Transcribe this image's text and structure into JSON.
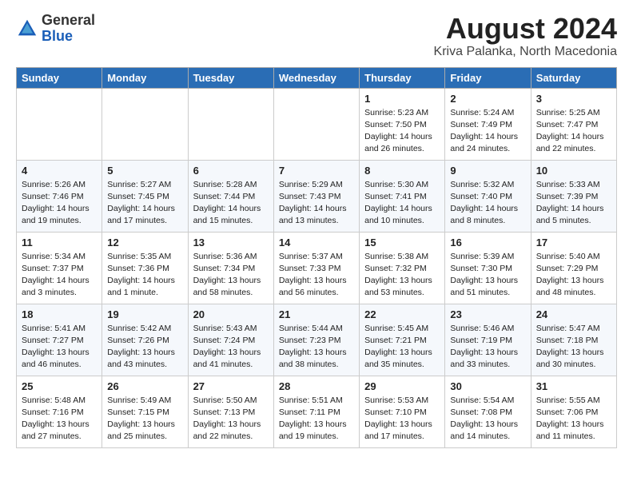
{
  "logo": {
    "general": "General",
    "blue": "Blue"
  },
  "title": {
    "month_year": "August 2024",
    "location": "Kriva Palanka, North Macedonia"
  },
  "headers": [
    "Sunday",
    "Monday",
    "Tuesday",
    "Wednesday",
    "Thursday",
    "Friday",
    "Saturday"
  ],
  "weeks": [
    [
      {
        "day": "",
        "info": ""
      },
      {
        "day": "",
        "info": ""
      },
      {
        "day": "",
        "info": ""
      },
      {
        "day": "",
        "info": ""
      },
      {
        "day": "1",
        "info": "Sunrise: 5:23 AM\nSunset: 7:50 PM\nDaylight: 14 hours and 26 minutes."
      },
      {
        "day": "2",
        "info": "Sunrise: 5:24 AM\nSunset: 7:49 PM\nDaylight: 14 hours and 24 minutes."
      },
      {
        "day": "3",
        "info": "Sunrise: 5:25 AM\nSunset: 7:47 PM\nDaylight: 14 hours and 22 minutes."
      }
    ],
    [
      {
        "day": "4",
        "info": "Sunrise: 5:26 AM\nSunset: 7:46 PM\nDaylight: 14 hours and 19 minutes."
      },
      {
        "day": "5",
        "info": "Sunrise: 5:27 AM\nSunset: 7:45 PM\nDaylight: 14 hours and 17 minutes."
      },
      {
        "day": "6",
        "info": "Sunrise: 5:28 AM\nSunset: 7:44 PM\nDaylight: 14 hours and 15 minutes."
      },
      {
        "day": "7",
        "info": "Sunrise: 5:29 AM\nSunset: 7:43 PM\nDaylight: 14 hours and 13 minutes."
      },
      {
        "day": "8",
        "info": "Sunrise: 5:30 AM\nSunset: 7:41 PM\nDaylight: 14 hours and 10 minutes."
      },
      {
        "day": "9",
        "info": "Sunrise: 5:32 AM\nSunset: 7:40 PM\nDaylight: 14 hours and 8 minutes."
      },
      {
        "day": "10",
        "info": "Sunrise: 5:33 AM\nSunset: 7:39 PM\nDaylight: 14 hours and 5 minutes."
      }
    ],
    [
      {
        "day": "11",
        "info": "Sunrise: 5:34 AM\nSunset: 7:37 PM\nDaylight: 14 hours and 3 minutes."
      },
      {
        "day": "12",
        "info": "Sunrise: 5:35 AM\nSunset: 7:36 PM\nDaylight: 14 hours and 1 minute."
      },
      {
        "day": "13",
        "info": "Sunrise: 5:36 AM\nSunset: 7:34 PM\nDaylight: 13 hours and 58 minutes."
      },
      {
        "day": "14",
        "info": "Sunrise: 5:37 AM\nSunset: 7:33 PM\nDaylight: 13 hours and 56 minutes."
      },
      {
        "day": "15",
        "info": "Sunrise: 5:38 AM\nSunset: 7:32 PM\nDaylight: 13 hours and 53 minutes."
      },
      {
        "day": "16",
        "info": "Sunrise: 5:39 AM\nSunset: 7:30 PM\nDaylight: 13 hours and 51 minutes."
      },
      {
        "day": "17",
        "info": "Sunrise: 5:40 AM\nSunset: 7:29 PM\nDaylight: 13 hours and 48 minutes."
      }
    ],
    [
      {
        "day": "18",
        "info": "Sunrise: 5:41 AM\nSunset: 7:27 PM\nDaylight: 13 hours and 46 minutes."
      },
      {
        "day": "19",
        "info": "Sunrise: 5:42 AM\nSunset: 7:26 PM\nDaylight: 13 hours and 43 minutes."
      },
      {
        "day": "20",
        "info": "Sunrise: 5:43 AM\nSunset: 7:24 PM\nDaylight: 13 hours and 41 minutes."
      },
      {
        "day": "21",
        "info": "Sunrise: 5:44 AM\nSunset: 7:23 PM\nDaylight: 13 hours and 38 minutes."
      },
      {
        "day": "22",
        "info": "Sunrise: 5:45 AM\nSunset: 7:21 PM\nDaylight: 13 hours and 35 minutes."
      },
      {
        "day": "23",
        "info": "Sunrise: 5:46 AM\nSunset: 7:19 PM\nDaylight: 13 hours and 33 minutes."
      },
      {
        "day": "24",
        "info": "Sunrise: 5:47 AM\nSunset: 7:18 PM\nDaylight: 13 hours and 30 minutes."
      }
    ],
    [
      {
        "day": "25",
        "info": "Sunrise: 5:48 AM\nSunset: 7:16 PM\nDaylight: 13 hours and 27 minutes."
      },
      {
        "day": "26",
        "info": "Sunrise: 5:49 AM\nSunset: 7:15 PM\nDaylight: 13 hours and 25 minutes."
      },
      {
        "day": "27",
        "info": "Sunrise: 5:50 AM\nSunset: 7:13 PM\nDaylight: 13 hours and 22 minutes."
      },
      {
        "day": "28",
        "info": "Sunrise: 5:51 AM\nSunset: 7:11 PM\nDaylight: 13 hours and 19 minutes."
      },
      {
        "day": "29",
        "info": "Sunrise: 5:53 AM\nSunset: 7:10 PM\nDaylight: 13 hours and 17 minutes."
      },
      {
        "day": "30",
        "info": "Sunrise: 5:54 AM\nSunset: 7:08 PM\nDaylight: 13 hours and 14 minutes."
      },
      {
        "day": "31",
        "info": "Sunrise: 5:55 AM\nSunset: 7:06 PM\nDaylight: 13 hours and 11 minutes."
      }
    ]
  ]
}
